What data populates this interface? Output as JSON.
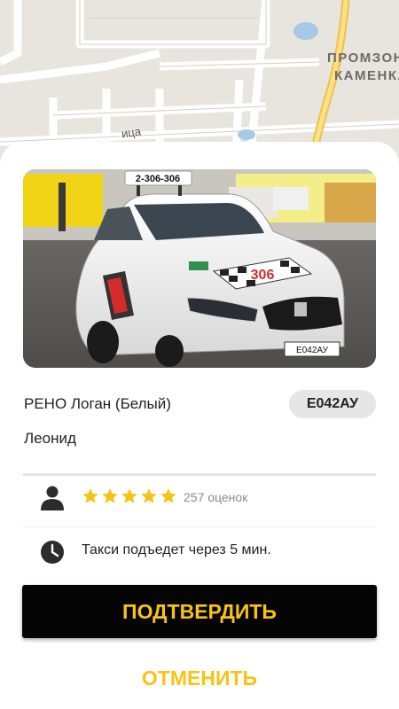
{
  "map": {
    "district_line1": "ПРОМЗОН",
    "district_line2": "КАМЕНКА",
    "street_fragment": "ица"
  },
  "car_photo": {
    "sign_text": "2-306-306",
    "plate_text": "Е042АУ"
  },
  "car": {
    "model": "РЕНО Логан (Белый)",
    "plate": "Е042АУ"
  },
  "driver": {
    "name": "Леонид",
    "rating_stars": 5,
    "reviews_label": "257 оценок"
  },
  "eta": {
    "text": "Такси подъедет через 5 мин."
  },
  "actions": {
    "confirm_label": "ПОДТВЕРДИТЬ",
    "cancel_label": "ОТМЕНИТЬ"
  },
  "colors": {
    "accent": "#f7c316",
    "button_bg": "#050505",
    "star": "#f7c316"
  },
  "icons": {
    "driver": "person-icon",
    "time": "clock-icon",
    "rating": "star-icon"
  }
}
